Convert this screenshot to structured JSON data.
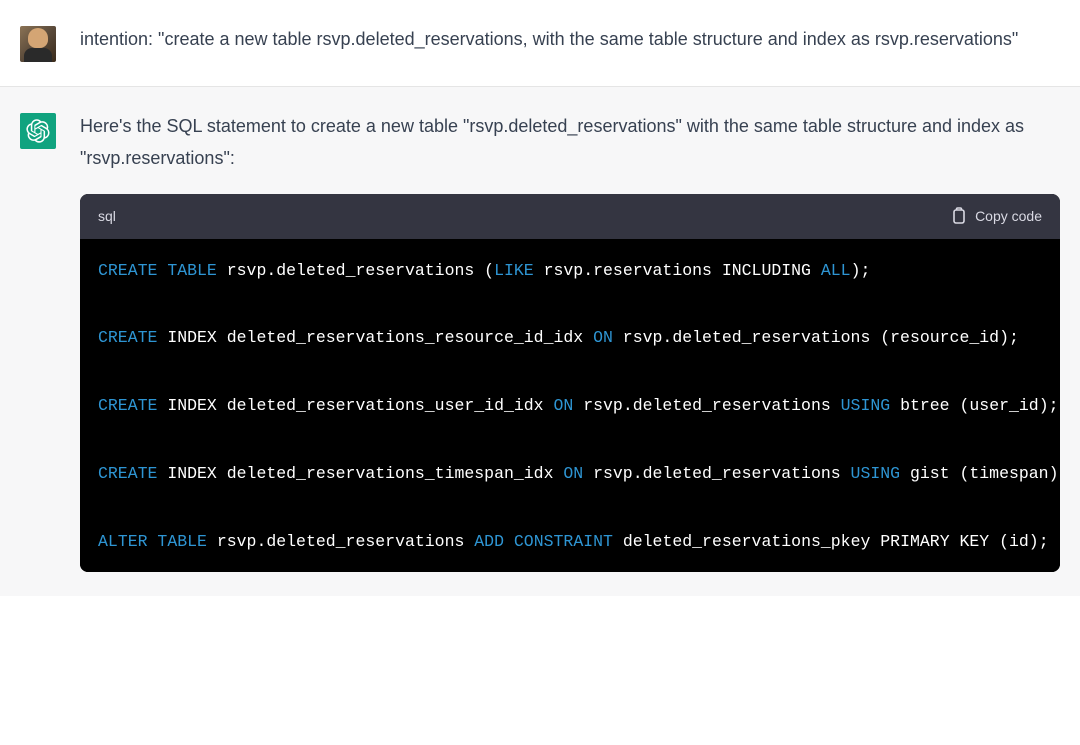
{
  "user_message": {
    "text": "intention: \"create a new table rsvp.deleted_reservations, with the same table structure and index as rsvp.reservations\""
  },
  "assistant_message": {
    "intro_text": "Here's the SQL statement to create a new table \"rsvp.deleted_reservations\" with the same table structure and index as \"rsvp.reservations\":"
  },
  "code_block": {
    "language": "sql",
    "copy_label": "Copy code",
    "lines": [
      {
        "tokens": [
          {
            "t": "CREATE",
            "c": "kw-create"
          },
          {
            "t": " ",
            "c": "plain"
          },
          {
            "t": "TABLE",
            "c": "kw-table"
          },
          {
            "t": " rsvp.deleted_reservations (",
            "c": "plain"
          },
          {
            "t": "LIKE",
            "c": "kw-like"
          },
          {
            "t": " rsvp.reservations INCLUDING ",
            "c": "plain"
          },
          {
            "t": "ALL",
            "c": "kw-all"
          },
          {
            "t": ");",
            "c": "plain"
          }
        ]
      },
      {
        "tokens": [
          {
            "t": "CREATE",
            "c": "kw-create"
          },
          {
            "t": " INDEX deleted_reservations_resource_id_idx ",
            "c": "plain"
          },
          {
            "t": "ON",
            "c": "kw-on"
          },
          {
            "t": " rsvp.deleted_reservations (resource_id);",
            "c": "plain"
          }
        ]
      },
      {
        "tokens": [
          {
            "t": "CREATE",
            "c": "kw-create"
          },
          {
            "t": " INDEX deleted_reservations_user_id_idx ",
            "c": "plain"
          },
          {
            "t": "ON",
            "c": "kw-on"
          },
          {
            "t": " rsvp.deleted_reservations ",
            "c": "plain"
          },
          {
            "t": "USING",
            "c": "kw-using"
          },
          {
            "t": " btree (user_id);",
            "c": "plain"
          }
        ]
      },
      {
        "tokens": [
          {
            "t": "CREATE",
            "c": "kw-create"
          },
          {
            "t": " INDEX deleted_reservations_timespan_idx ",
            "c": "plain"
          },
          {
            "t": "ON",
            "c": "kw-on"
          },
          {
            "t": " rsvp.deleted_reservations ",
            "c": "plain"
          },
          {
            "t": "USING",
            "c": "kw-using"
          },
          {
            "t": " gist (timespan);",
            "c": "plain"
          }
        ]
      },
      {
        "tokens": [
          {
            "t": "ALTER",
            "c": "kw-alter"
          },
          {
            "t": " ",
            "c": "plain"
          },
          {
            "t": "TABLE",
            "c": "kw-table"
          },
          {
            "t": " rsvp.deleted_reservations ",
            "c": "plain"
          },
          {
            "t": "ADD",
            "c": "kw-add"
          },
          {
            "t": " ",
            "c": "plain"
          },
          {
            "t": "CONSTRAINT",
            "c": "kw-constraint"
          },
          {
            "t": " deleted_reservations_pkey PRIMARY KEY (id);",
            "c": "plain"
          }
        ]
      }
    ]
  },
  "icons": {
    "bot": "openai-logo",
    "clipboard": "clipboard-icon"
  }
}
